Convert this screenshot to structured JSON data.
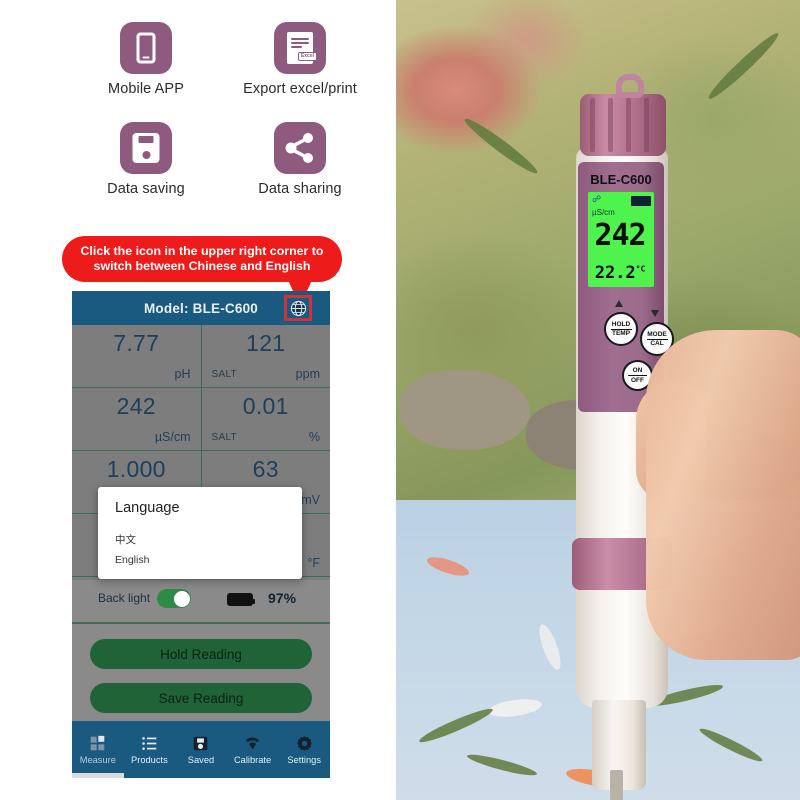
{
  "features": [
    {
      "label": "Mobile APP",
      "icon": "phone-icon"
    },
    {
      "label": "Export excel/print",
      "icon": "excel-document-icon",
      "tag": "Excel"
    },
    {
      "label": "Data saving",
      "icon": "floppy-disk-icon"
    },
    {
      "label": "Data sharing",
      "icon": "share-icon"
    }
  ],
  "callout": {
    "text": "Click the icon in the upper right corner to switch between Chinese and English",
    "color": "#ee1b1b"
  },
  "app": {
    "header": {
      "title": "Model: BLE-C600",
      "globe_icon": "globe-icon",
      "bar_color": "#1a5a80",
      "highlight_color": "#cf3333"
    },
    "readings": [
      [
        {
          "value": "7.77",
          "prefix": "",
          "unit": "pH"
        },
        {
          "value": "121",
          "prefix": "SALT",
          "unit": "ppm"
        }
      ],
      [
        {
          "value": "242",
          "prefix": "",
          "unit": "µS/cm"
        },
        {
          "value": "0.01",
          "prefix": "SALT",
          "unit": "%"
        }
      ],
      [
        {
          "value": "1.000",
          "prefix": "",
          "unit": ""
        },
        {
          "value": "63",
          "prefix": "",
          "unit": "mV"
        }
      ],
      [
        {
          "value": "",
          "prefix": "",
          "unit": ""
        },
        {
          "value": "",
          "prefix": "",
          "unit": "°F"
        }
      ]
    ],
    "backlight": {
      "label": "Back light",
      "enabled": true,
      "toggle_color": "#2e8b47",
      "battery_percent": "97%"
    },
    "buttons": {
      "hold": "Hold Reading",
      "save": "Save Reading",
      "color": "#1f6336"
    },
    "nav": [
      {
        "label": "Measure",
        "icon": "grid-measure-icon",
        "active": true
      },
      {
        "label": "Products",
        "icon": "list-icon",
        "active": false
      },
      {
        "label": "Saved",
        "icon": "floppy-disk-icon",
        "active": false
      },
      {
        "label": "Calibrate",
        "icon": "signal-wifi-icon",
        "active": false
      },
      {
        "label": "Settings",
        "icon": "gear-icon",
        "active": false
      }
    ],
    "language_dialog": {
      "title": "Language",
      "options": [
        "中文",
        "English"
      ]
    }
  },
  "device": {
    "model": "BLE-C600",
    "lcd": {
      "bluetooth_icon": "bluetooth-icon",
      "battery_icon": "battery-icon",
      "unit": "µS/cm",
      "main_value": "242",
      "temp_value": "22.2",
      "temp_unit": "°C",
      "screen_color": "#4ef34e"
    },
    "buttons": [
      {
        "top": "HOLD",
        "bottom": "TEMP"
      },
      {
        "top": "MODE",
        "bottom": "CAL"
      },
      {
        "top": "ON",
        "bottom": "OFF"
      }
    ],
    "cap_color": "#b4738f"
  }
}
